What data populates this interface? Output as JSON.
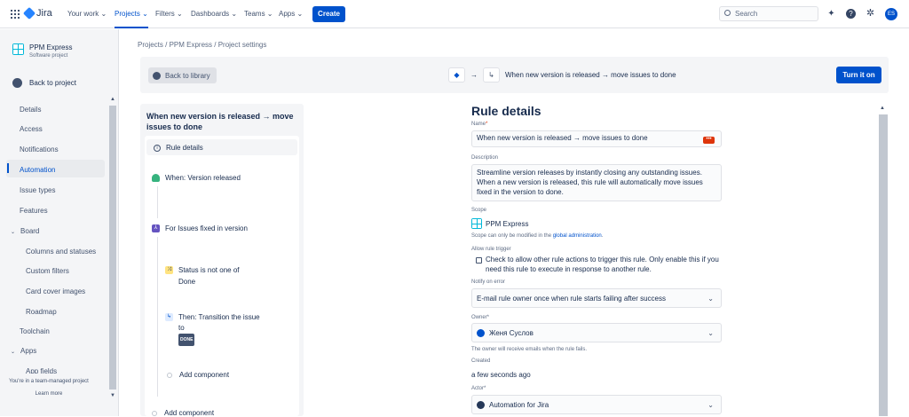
{
  "topbar": {
    "logo_text": "Jira",
    "nav": [
      "Your work",
      "Projects",
      "Filters",
      "Dashboards",
      "Teams",
      "Apps"
    ],
    "active_nav": "Projects",
    "create_label": "Create",
    "search_placeholder": "Search",
    "avatar_initials": "ES",
    "icons": [
      "app-switcher-icon",
      "notifications-icon",
      "help-icon",
      "settings-icon"
    ]
  },
  "sidebar": {
    "project_name": "PPM Express",
    "project_type": "Software project",
    "back_label": "Back to project",
    "items": [
      "Details",
      "Access",
      "Notifications",
      "Automation",
      "Issue types",
      "Features",
      "Board",
      "Columns and statuses",
      "Custom filters",
      "Card cover images",
      "Roadmap",
      "Toolchain",
      "Apps",
      "App fields"
    ],
    "active_item": "Automation",
    "footer_line1": "You're in a team-managed project",
    "footer_line2": "Learn more"
  },
  "breadcrumb": "Projects  /  PPM Express  /  Project settings",
  "header": {
    "back_label": "Back to library",
    "arrow": "→",
    "rule_name": "When new version is released → move issues to done",
    "turn_on_label": "Turn it on"
  },
  "rule_panel": {
    "title": "When new version is released → move issues to done",
    "rule_details": "Rule details",
    "trigger": "When: Version released",
    "branch": "For Issues fixed in version",
    "condition_line1": "Status is not one of",
    "condition_line2": "Done",
    "action_line1": "Then: Transition the issue",
    "action_line2": "to",
    "done_tag": "DONE",
    "add_component": "Add component"
  },
  "details": {
    "title": "Rule details",
    "name_label": "Name",
    "required": "*",
    "name_value": "When new version is released → move issues to done",
    "description_label": "Description",
    "description_value": "Streamline version releases by instantly closing any outstanding issues. When a new version is released, this rule will automatically move issues fixed in the version to done.",
    "scope_label": "Scope",
    "scope_value": "PPM Express",
    "scope_note_prefix": "Scope can only be modified in the ",
    "scope_note_link": "global administration",
    "scope_note_suffix": ".",
    "allow_trigger_label": "Allow rule trigger",
    "allow_trigger_text": "Check to allow other rule actions to trigger this rule. Only enable this if you need this rule to execute in response to another rule.",
    "notify_label": "Notify on error",
    "notify_value": "E-mail rule owner once when rule starts failing after success",
    "owner_label": "Owner",
    "owner_value": "Женя Суслов",
    "owner_note": "The owner will receive emails when the rule fails.",
    "created_label": "Created",
    "created_value": "a few seconds ago",
    "actor_label": "Actor",
    "actor_value": "Automation for Jira"
  }
}
